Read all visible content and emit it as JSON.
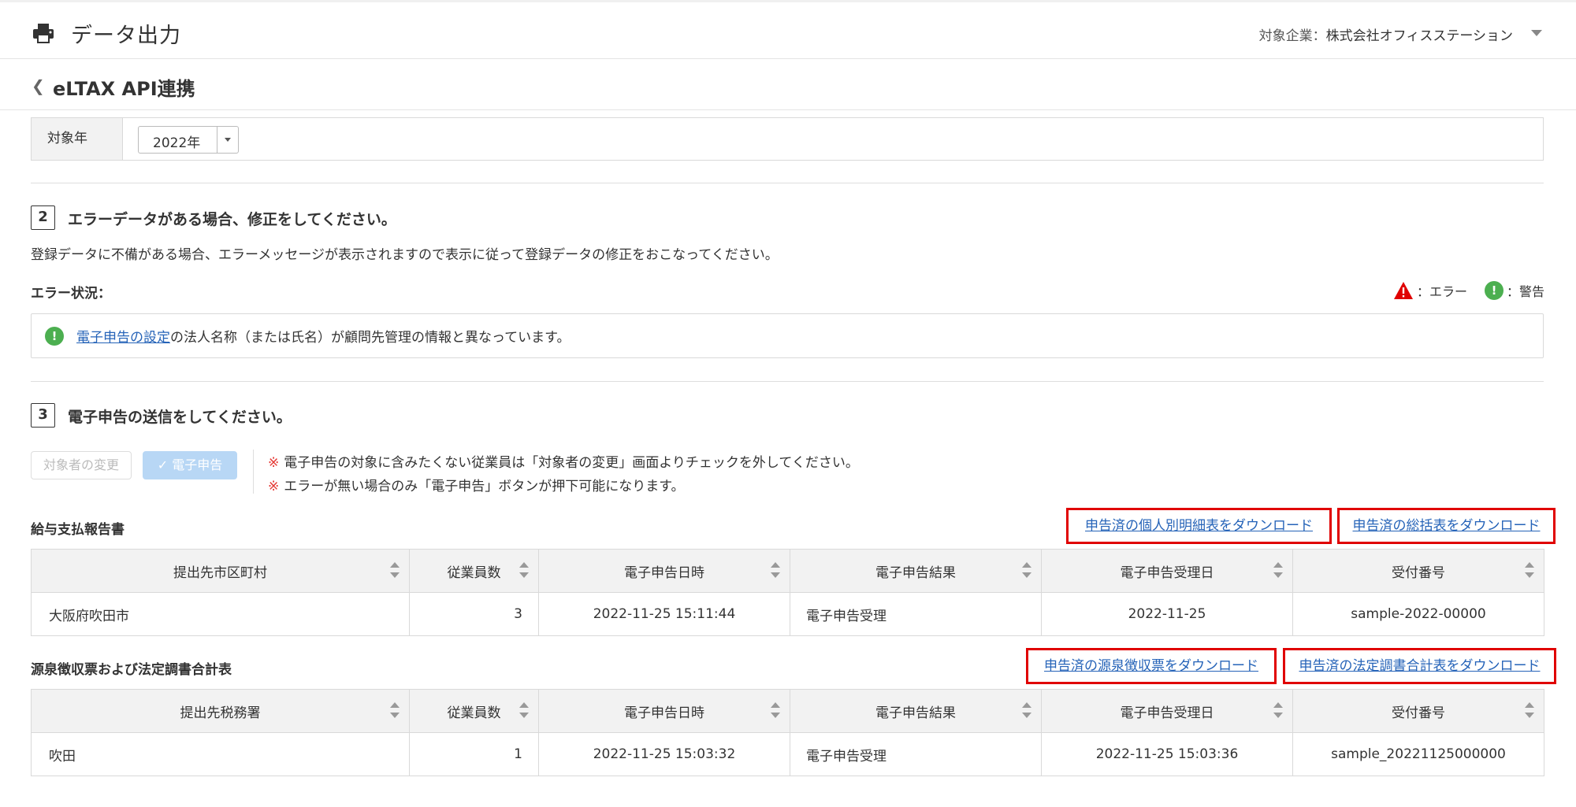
{
  "header": {
    "title": "データ出力",
    "company_label": "対象企業：",
    "company_name": "株式会社オフィスステーション"
  },
  "subheader": {
    "back_icon": "chevron-left-icon",
    "title": "eLTAX API連携"
  },
  "year_filter": {
    "label": "対象年",
    "selected": "2022年"
  },
  "step2": {
    "number": "2",
    "title": "エラーデータがある場合、修正をしてください。",
    "description": "登録データに不備がある場合、エラーメッセージが表示されますので表示に従って登録データの修正をおこなってください。",
    "status_label": "エラー状況：",
    "legend_error": "：エラー",
    "legend_warning": "：警告",
    "message_link": "電子申告の設定",
    "message_text": "の法人名称（または氏名）が顧問先管理の情報と異なっています。",
    "colors": {
      "error": "#e00000",
      "warning": "#4caf50"
    }
  },
  "step3": {
    "number": "3",
    "title": "電子申告の送信をしてください。",
    "change_button": "対象者の変更",
    "efile_button": "電子申告",
    "note_mark": "※",
    "note1": "電子申告の対象に含みたくない従業員は「対象者の変更」画面よりチェックを外してください。",
    "note2": "エラーが無い場合のみ「電子申告」ボタンが押下可能になります。"
  },
  "salary_report": {
    "label": "給与支払報告書",
    "download_individual": "申告済の個人別明細表をダウンロード",
    "download_summary": "申告済の総括表をダウンロード",
    "columns": [
      "提出先市区町村",
      "従業員数",
      "電子申告日時",
      "電子申告結果",
      "電子申告受理日",
      "受付番号"
    ],
    "rows": [
      {
        "city": "大阪府吹田市",
        "employees": "3",
        "filed_at": "2022-11-25 15:11:44",
        "result": "電子申告受理",
        "accepted": "2022-11-25",
        "receipt": "sample-2022-00000"
      }
    ]
  },
  "withholding": {
    "label": "源泉徴収票および法定調書合計表",
    "download_slips": "申告済の源泉徴収票をダウンロード",
    "download_totals": "申告済の法定調書合計表をダウンロード",
    "columns": [
      "提出先税務署",
      "従業員数",
      "電子申告日時",
      "電子申告結果",
      "電子申告受理日",
      "受付番号"
    ],
    "rows": [
      {
        "office": "吹田",
        "employees": "1",
        "filed_at": "2022-11-25 15:03:32",
        "result": "電子申告受理",
        "accepted": "2022-11-25 15:03:36",
        "receipt": "sample_20221125000000"
      }
    ]
  },
  "highlight_color": "#e00000"
}
